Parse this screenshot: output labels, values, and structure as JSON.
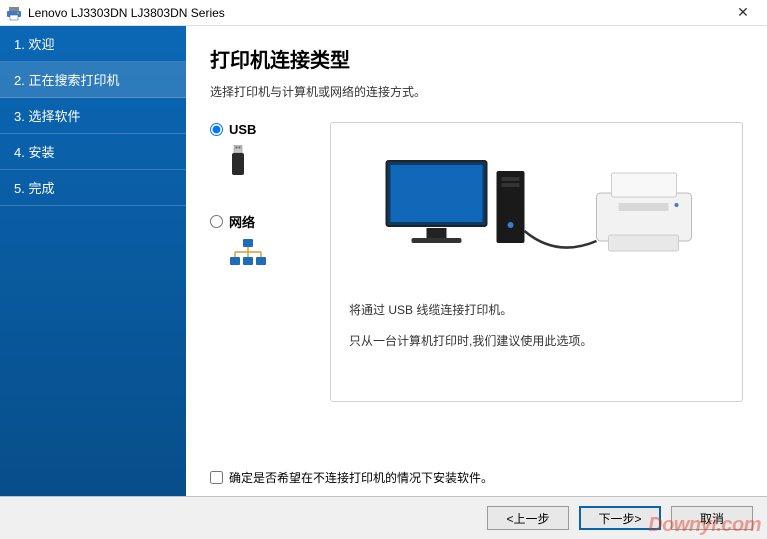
{
  "window": {
    "title": "Lenovo LJ3303DN LJ3803DN Series"
  },
  "sidebar": {
    "items": [
      {
        "label": "1. 欢迎"
      },
      {
        "label": "2. 正在搜索打印机"
      },
      {
        "label": "3. 选择软件"
      },
      {
        "label": "4. 安装"
      },
      {
        "label": "5. 完成"
      }
    ],
    "active_index": 1
  },
  "content": {
    "heading": "打印机连接类型",
    "subtext": "选择打印机与计算机或网络的连接方式。",
    "options": {
      "usb_label": "USB",
      "network_label": "网络"
    },
    "description": {
      "line1": "将通过 USB 线缆连接打印机。",
      "line2": "只从一台计算机打印时,我们建议使用此选项。"
    },
    "checkbox_label": "确定是否希望在不连接打印机的情况下安装软件。"
  },
  "buttons": {
    "back": "<上一步",
    "next": "下一步>",
    "cancel": "取消"
  },
  "watermark": "Downyi.com"
}
